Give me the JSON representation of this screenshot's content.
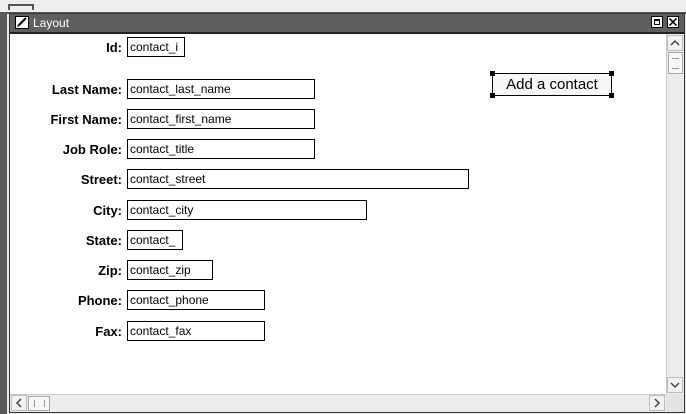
{
  "window": {
    "title": "Layout",
    "controls": [
      "maximize",
      "close"
    ]
  },
  "form": {
    "fields": [
      {
        "label": "Id:",
        "value": "contact_i"
      },
      {
        "label": "Last Name:",
        "value": "contact_last_name"
      },
      {
        "label": "First Name:",
        "value": "contact_first_name"
      },
      {
        "label": "Job Role:",
        "value": "contact_title"
      },
      {
        "label": "Street:",
        "value": "contact_street"
      },
      {
        "label": "City:",
        "value": "contact_city"
      },
      {
        "label": "State:",
        "value": "contact_"
      },
      {
        "label": "Zip:",
        "value": "contact_zip"
      },
      {
        "label": "Phone:",
        "value": "contact_phone"
      },
      {
        "label": "Fax:",
        "value": "contact_fax"
      }
    ],
    "add_button_label": "Add a contact"
  },
  "scrollbars": {
    "up_arrow": "^",
    "down_arrow": "v",
    "left_arrow": "<",
    "right_arrow": ">"
  },
  "colors": {
    "titlebar": "#5f5f5f",
    "title_text": "#ffffff",
    "canvas": "#ffffff"
  }
}
